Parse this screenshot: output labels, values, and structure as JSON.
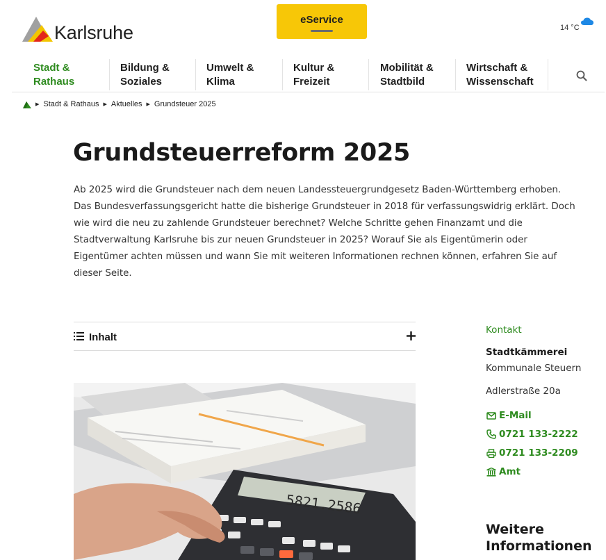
{
  "header": {
    "logo_text": "Karlsruhe",
    "eservice_label": "eService",
    "weather_temp": "14 °C"
  },
  "nav": {
    "items": [
      {
        "label": "Stadt &\nRathaus",
        "active": true
      },
      {
        "label": "Bildung &\nSoziales"
      },
      {
        "label": "Umwelt &\nKlima"
      },
      {
        "label": "Kultur &\nFreizeit"
      },
      {
        "label": "Mobilität &\nStadtbild"
      },
      {
        "label": "Wirtschaft &\nWissenschaft"
      }
    ]
  },
  "breadcrumb": [
    "Stadt & Rathaus",
    "Aktuelles",
    "Grundsteuer 2025"
  ],
  "main": {
    "title": "Grundsteuerreform 2025",
    "intro": "Ab 2025 wird die Grundsteuer nach dem neuen Landessteuergrundgesetz Baden-Württemberg erhoben. Das Bundesverfassungsgericht hatte die bisherige Grundsteuer in 2018 für verfassungswidrig erklärt. Doch wie wird die neu zu zahlende Grundsteuer berechnet? Welche Schritte gehen Finanzamt und die Stadtverwaltung Karlsruhe bis zur neuen Grundsteuer in 2025? Worauf Sie als Eigentümerin oder Eigentümer achten müssen und wann Sie mit weiteren Informationen rechnen können, erfahren Sie auf dieser Seite.",
    "toc_label": "Inhalt",
    "calculator_display": "5821.2586"
  },
  "sidebar": {
    "contact_heading": "Kontakt",
    "org": "Stadtkämmerei",
    "dept": "Kommunale Steuern",
    "address": "Adlerstraße 20a",
    "email_label": "E-Mail",
    "phone": "0721 133-2222",
    "fax": "0721 133-2209",
    "office_label": "Amt",
    "more_heading": "Weitere\nInformationen"
  },
  "colors": {
    "accent_green": "#2e8b1f",
    "eservice_yellow": "#f7c707",
    "weather_blue": "#1e88e5"
  },
  "icons": [
    "logo-mark",
    "cloud-icon",
    "search-icon",
    "home-icon",
    "list-icon",
    "plus-icon",
    "mail-icon",
    "phone-icon",
    "fax-icon",
    "office-icon"
  ]
}
